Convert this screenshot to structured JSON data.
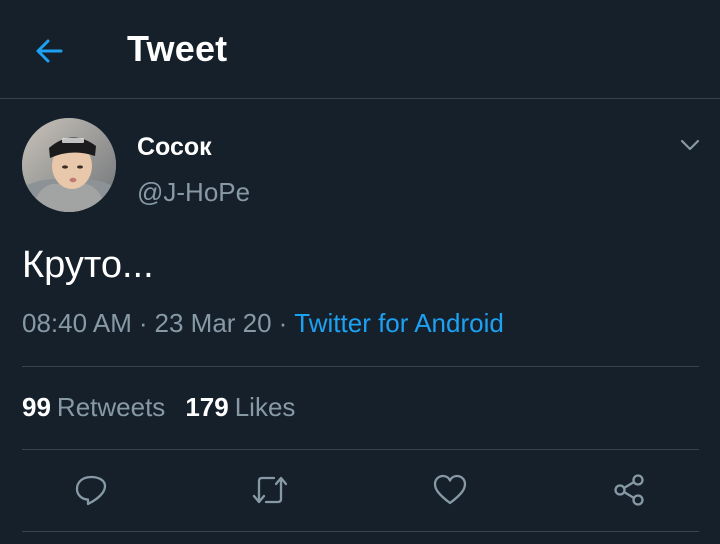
{
  "header": {
    "title": "Tweet",
    "back_icon": "arrow-left-icon"
  },
  "tweet": {
    "author": {
      "display_name": "Сосок",
      "handle": "@J-HoPe"
    },
    "text": "Круто...",
    "time": "08:40 AM",
    "date": "23 Mar 20",
    "separator": "·",
    "source": "Twitter for Android",
    "stats": {
      "retweets_count": "99",
      "retweets_label": "Retweets",
      "likes_count": "179",
      "likes_label": "Likes"
    },
    "actions": [
      "reply-icon",
      "retweet-icon",
      "like-icon",
      "share-icon"
    ]
  },
  "colors": {
    "background": "#15202b",
    "accent": "#1da1f2",
    "secondary_text": "#8899a6",
    "divider": "#38444d"
  }
}
